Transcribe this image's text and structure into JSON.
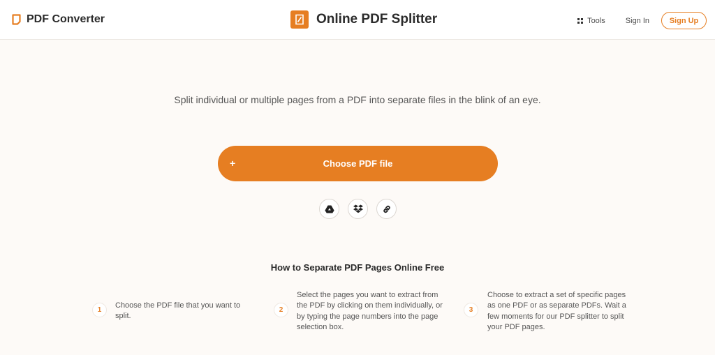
{
  "header": {
    "brand_name": "PDF Converter",
    "page_title": "Online PDF Splitter",
    "nav": {
      "tools_label": "Tools",
      "signin_label": "Sign In",
      "signup_label": "Sign Up"
    }
  },
  "hero": {
    "subtitle": "Split individual or multiple pages from a PDF into separate files in the blink of an eye.",
    "choose_button_plus": "+",
    "choose_button_label": "Choose PDF file",
    "sources": [
      {
        "icon": "google-drive-icon"
      },
      {
        "icon": "dropbox-icon"
      },
      {
        "icon": "link-icon"
      }
    ]
  },
  "how_to": {
    "title": "How to Separate PDF Pages Online Free",
    "steps": [
      {
        "number": "1",
        "text": "Choose the PDF file that you want to split."
      },
      {
        "number": "2",
        "text": "Select the pages you want to extract from the PDF by clicking on them individually, or by typing the page numbers into the page selection box."
      },
      {
        "number": "3",
        "text": "Choose to extract a set of specific pages as one PDF or as separate PDFs. Wait a few moments for our PDF splitter to split your PDF pages."
      }
    ]
  },
  "colors": {
    "accent": "#e67e22",
    "background": "#fdfaf7",
    "header_bg": "#ffffff",
    "text_dark": "#2b2b2b",
    "text_muted": "#555555"
  }
}
